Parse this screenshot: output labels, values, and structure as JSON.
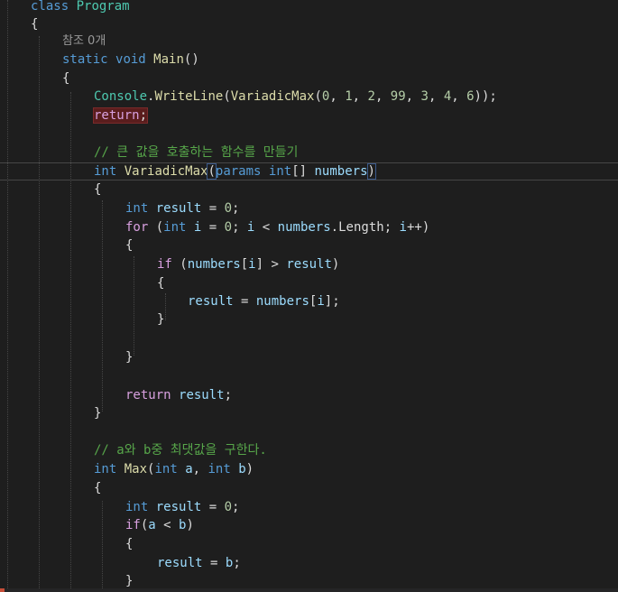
{
  "editor": {
    "language": "C#",
    "colors": {
      "background": "#1e1e1e",
      "keyword": "#569cd6",
      "type": "#4ec9b0",
      "method": "#dcdcaa",
      "variable": "#9cdcfe",
      "number": "#b5cea8",
      "comment": "#57a64a",
      "error_highlight": "#5a1d1d"
    },
    "lines": {
      "l1": {
        "kw": "class",
        "name": "Program"
      },
      "l2": {
        "brace": "{"
      },
      "l3": {
        "codelens": "참조 0개"
      },
      "l4": {
        "kw_static": "static",
        "kw_void": "void",
        "name": "Main",
        "paren": "()"
      },
      "l5": {
        "brace": "{"
      },
      "l6": {
        "type_console": "Console",
        "dot": ".",
        "method_writeline": "WriteLine",
        "open": "(",
        "method_variadic": "VariadicMax",
        "open2": "(",
        "args": [
          {
            "num": "0",
            "sep": ", "
          },
          {
            "num": "1",
            "sep": ", "
          },
          {
            "num": "2",
            "sep": ", "
          },
          {
            "num": "99",
            "sep": ", "
          },
          {
            "num": "3",
            "sep": ", "
          },
          {
            "num": "4",
            "sep": ", "
          },
          {
            "num": "6",
            "sep": ""
          }
        ],
        "close": "));"
      },
      "l7": {
        "kw_return": "return",
        "semi": ";"
      },
      "l9": {
        "comment": "// 큰 값을 호출하는 함수를 만들기"
      },
      "l10": {
        "kw_int": "int",
        "name": "VariadicMax",
        "open": "(",
        "kw_params": "params",
        "kw_int2": "int",
        "brackets": "[]",
        "param": "numbers",
        "close": ")"
      },
      "l11": {
        "brace": "{"
      },
      "l12": {
        "kw_int": "int",
        "var": "result",
        "op": " = ",
        "num": "0",
        "semi": ";"
      },
      "l13": {
        "kw_for": "for",
        "open": " (",
        "kw_int": "int",
        "var_i": "i",
        "op_eq": " = ",
        "num": "0",
        "semi1": "; ",
        "var_i2": "i",
        "op_lt": " < ",
        "var_numbers": "numbers",
        "dot": ".",
        "prop": "Length",
        "semi2": "; ",
        "var_i3": "i",
        "inc": "++)"
      },
      "l14": {
        "brace": "{"
      },
      "l15": {
        "kw_if": "if",
        "open": " (",
        "var_numbers": "numbers",
        "idx_open": "[",
        "var_i": "i",
        "idx_close": "]",
        "op_gt": " > ",
        "var_result": "result",
        "close": ")"
      },
      "l16": {
        "brace": "{"
      },
      "l17": {
        "var_result": "result",
        "op": " = ",
        "var_numbers": "numbers",
        "idx_open": "[",
        "var_i": "i",
        "idx_close": "];"
      },
      "l18": {
        "brace": "}"
      },
      "l20": {
        "brace": "}"
      },
      "l22": {
        "kw_return": "return",
        "var_result": "result",
        "semi": ";"
      },
      "l23": {
        "brace": "}"
      },
      "l25": {
        "comment": "// a와 b중 최댓값을 구한다."
      },
      "l26": {
        "kw_int": "int",
        "name": "Max",
        "open": "(",
        "kw_int2": "int",
        "var_a": "a",
        "comma": ", ",
        "kw_int3": "int",
        "var_b": "b",
        "close": ")"
      },
      "l27": {
        "brace": "{"
      },
      "l28": {
        "kw_int": "int",
        "var": "result",
        "op": " = ",
        "num": "0",
        "semi": ";"
      },
      "l29": {
        "kw_if": "if",
        "open": "(",
        "var_a": "a",
        "op_lt": " < ",
        "var_b": "b",
        "close": ")"
      },
      "l30": {
        "brace": "{"
      },
      "l31": {
        "var_result": "result",
        "op": " = ",
        "var_b": "b",
        "semi": ";"
      },
      "l32": {
        "brace": "}"
      }
    }
  }
}
